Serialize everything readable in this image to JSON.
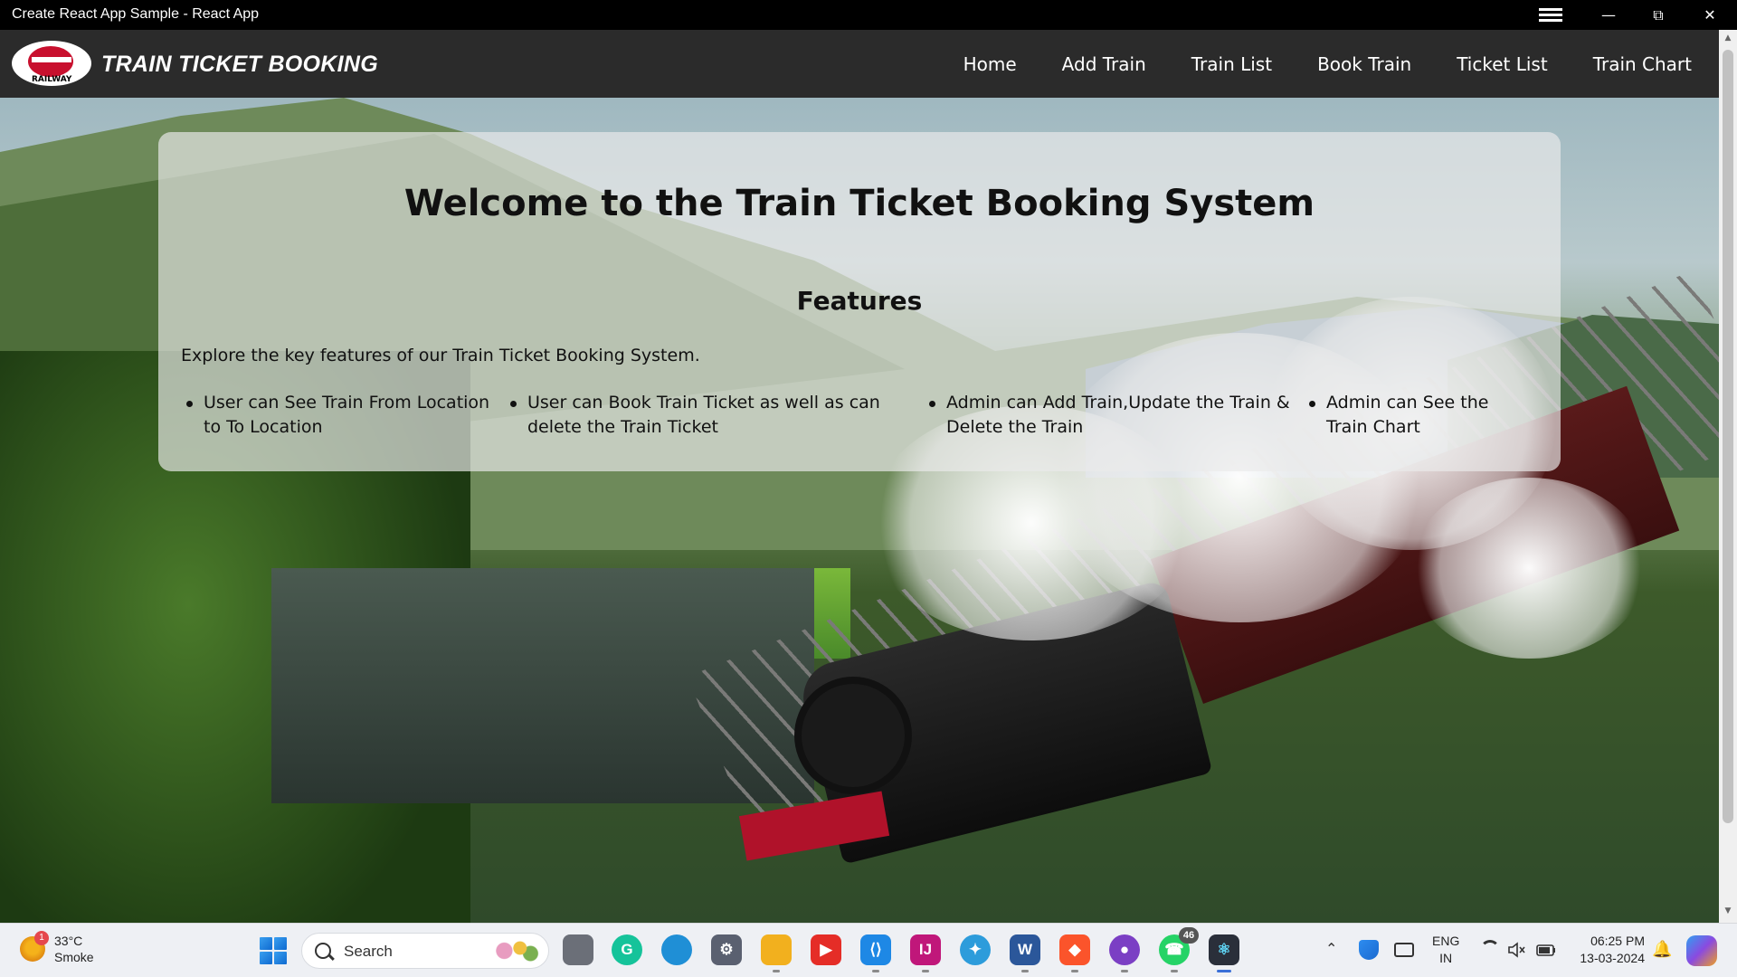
{
  "window": {
    "title": "Create React App Sample - React App",
    "controls": {
      "menu": "☰",
      "minimize": "—",
      "maximize": "⧉",
      "close": "✕"
    }
  },
  "navbar": {
    "logo_text": "RAILWAY",
    "brand": "TRAIN TICKET BOOKING",
    "links": [
      "Home",
      "Add Train",
      "Train List",
      "Book Train",
      "Ticket List",
      "Train Chart"
    ]
  },
  "main": {
    "heading": "Welcome to the Train Ticket Booking System",
    "features_heading": "Features",
    "intro": "Explore the key features of our Train Ticket Booking System.",
    "features": [
      "User can See Train From Location to To Location",
      "User can Book Train Ticket as well as can delete the Train Ticket",
      "Admin can Add Train,Update the Train & Delete the Train",
      "Admin can See the Train Chart"
    ]
  },
  "scrollbar": {
    "up_arrow": "▲",
    "down_arrow": "▼"
  },
  "taskbar": {
    "weather": {
      "temperature": "33°C",
      "condition": "Smoke",
      "badge": "1"
    },
    "search_label": "Search",
    "apps": [
      {
        "name": "task-view",
        "label": "",
        "color": "#6b6f78"
      },
      {
        "name": "grammarly",
        "label": "G",
        "color": "#15c39a"
      },
      {
        "name": "edge",
        "label": "",
        "color": "#1f8fd6"
      },
      {
        "name": "settings",
        "label": "⚙",
        "color": "#5a6070"
      },
      {
        "name": "file-explorer",
        "label": "",
        "color": "#f2b01e"
      },
      {
        "name": "youtube",
        "label": "▶",
        "color": "#e52d27"
      },
      {
        "name": "vscode",
        "label": "⟨⟩",
        "color": "#1e88e5"
      },
      {
        "name": "intellij",
        "label": "IJ",
        "color": "#c0177a"
      },
      {
        "name": "app-blue",
        "label": "✦",
        "color": "#2d9cdb"
      },
      {
        "name": "word",
        "label": "W",
        "color": "#2b579a"
      },
      {
        "name": "brave",
        "label": "◆",
        "color": "#fb542b"
      },
      {
        "name": "github",
        "label": "●",
        "color": "#7b3fc4"
      },
      {
        "name": "whatsapp",
        "label": "☎",
        "color": "#25d366"
      },
      {
        "name": "react",
        "label": "⚛",
        "color": "#2a2f3a"
      }
    ],
    "whatsapp_badge": "46",
    "tray": {
      "chevron": "⌃",
      "language": "ENG",
      "region": "IN",
      "time": "06:25 PM",
      "date": "13-03-2024",
      "bell": "🔔"
    }
  }
}
